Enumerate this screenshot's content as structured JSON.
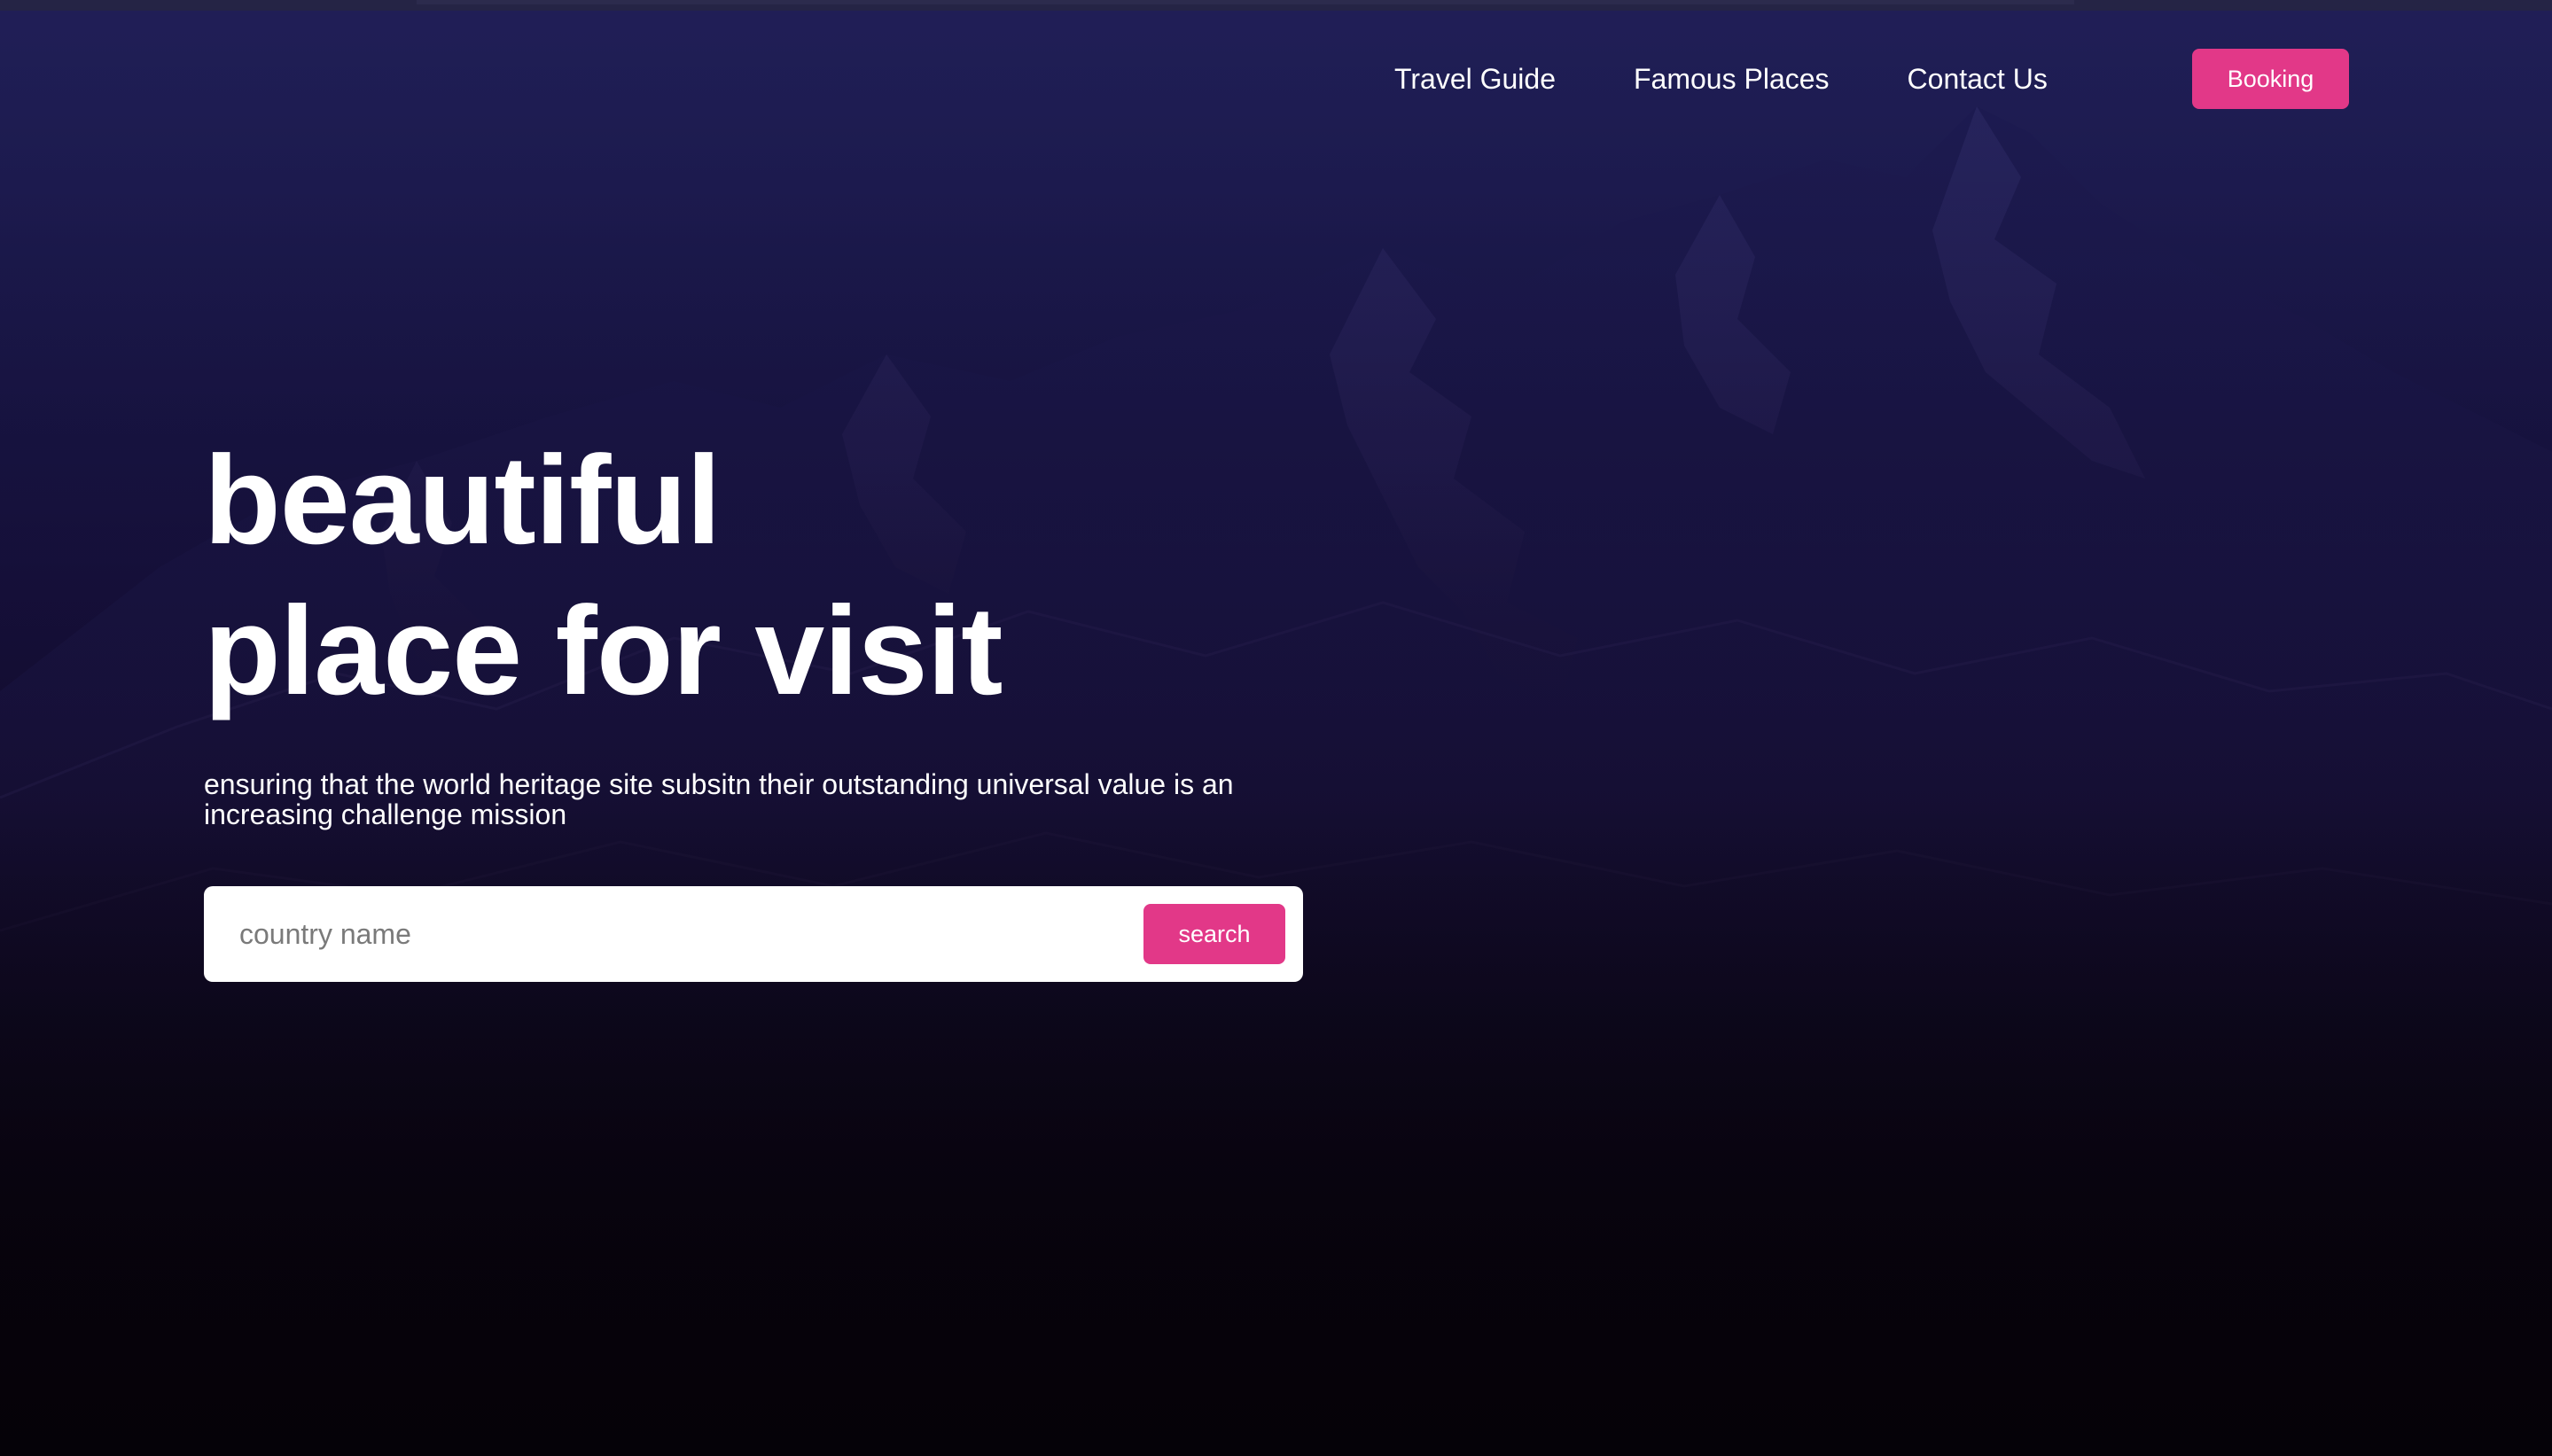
{
  "nav": {
    "items": [
      {
        "label": "Travel Guide"
      },
      {
        "label": "Famous Places"
      },
      {
        "label": "Contact Us"
      }
    ],
    "booking_label": "Booking"
  },
  "hero": {
    "title_line1": "beautiful",
    "title_line2": "place for visit",
    "subtitle": "ensuring that the world heritage site subsitn their outstanding universal value is an increasing challenge mission"
  },
  "search": {
    "placeholder": "country name",
    "value": "",
    "button_label": "search"
  },
  "colors": {
    "accent": "#e23888",
    "background_top": "#232259",
    "background_bottom": "#070309",
    "text": "#ffffff"
  }
}
